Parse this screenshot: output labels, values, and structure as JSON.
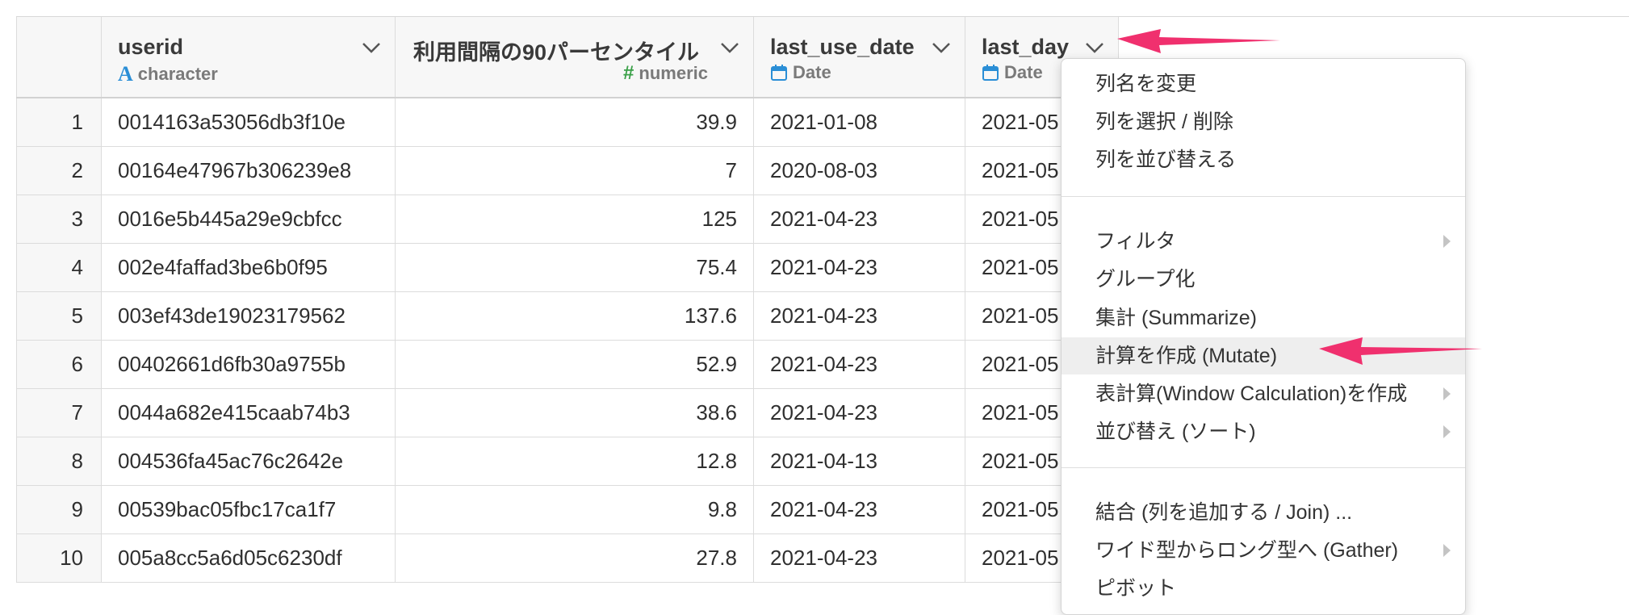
{
  "columns": [
    {
      "name": "userid",
      "type_label": "character",
      "type_icon": "character-type-icon",
      "align": "left"
    },
    {
      "name": "利用間隔の90パーセンタイル",
      "type_label": "numeric",
      "type_icon": "numeric-type-icon",
      "align": "right"
    },
    {
      "name": "last_use_date",
      "type_label": "Date",
      "type_icon": "calendar-icon",
      "align": "left"
    },
    {
      "name": "last_day",
      "type_label": "Date",
      "type_icon": "calendar-icon",
      "align": "left"
    }
  ],
  "rows": [
    {
      "num": "1",
      "userid": "0014163a53056db3f10e",
      "pct": "39.9",
      "last_use_date": "2021-01-08",
      "last_day": "2021-05"
    },
    {
      "num": "2",
      "userid": "00164e47967b306239e8",
      "pct": "7",
      "last_use_date": "2020-08-03",
      "last_day": "2021-05"
    },
    {
      "num": "3",
      "userid": "0016e5b445a29e9cbfcc",
      "pct": "125",
      "last_use_date": "2021-04-23",
      "last_day": "2021-05"
    },
    {
      "num": "4",
      "userid": "002e4faffad3be6b0f95",
      "pct": "75.4",
      "last_use_date": "2021-04-23",
      "last_day": "2021-05"
    },
    {
      "num": "5",
      "userid": "003ef43de19023179562",
      "pct": "137.6",
      "last_use_date": "2021-04-23",
      "last_day": "2021-05"
    },
    {
      "num": "6",
      "userid": "00402661d6fb30a9755b",
      "pct": "52.9",
      "last_use_date": "2021-04-23",
      "last_day": "2021-05"
    },
    {
      "num": "7",
      "userid": "0044a682e415caab74b3",
      "pct": "38.6",
      "last_use_date": "2021-04-23",
      "last_day": "2021-05"
    },
    {
      "num": "8",
      "userid": "004536fa45ac76c2642e",
      "pct": "12.8",
      "last_use_date": "2021-04-13",
      "last_day": "2021-05"
    },
    {
      "num": "9",
      "userid": "00539bac05fbc17ca1f7",
      "pct": "9.8",
      "last_use_date": "2021-04-23",
      "last_day": "2021-05"
    },
    {
      "num": "10",
      "userid": "005a8cc5a6d05c6230df",
      "pct": "27.8",
      "last_use_date": "2021-04-23",
      "last_day": "2021-05"
    }
  ],
  "menu": {
    "items": [
      {
        "label": "列名を変更",
        "submenu": false,
        "highlighted": false
      },
      {
        "label": "列を選択 / 削除",
        "submenu": false,
        "highlighted": false
      },
      {
        "label": "列を並び替える",
        "submenu": false,
        "highlighted": false
      },
      {
        "label": "フィルタ",
        "submenu": true,
        "highlighted": false
      },
      {
        "label": "グループ化",
        "submenu": false,
        "highlighted": false
      },
      {
        "label": "集計 (Summarize)",
        "submenu": false,
        "highlighted": false
      },
      {
        "label": "計算を作成 (Mutate)",
        "submenu": false,
        "highlighted": true
      },
      {
        "label": "表計算(Window Calculation)を作成",
        "submenu": true,
        "highlighted": false
      },
      {
        "label": "並び替え (ソート)",
        "submenu": true,
        "highlighted": false
      },
      {
        "label": "結合 (列を追加する / Join) ...",
        "submenu": false,
        "highlighted": false
      },
      {
        "label": "ワイド型からロング型へ (Gather)",
        "submenu": true,
        "highlighted": false
      },
      {
        "label": "ピボット",
        "submenu": false,
        "highlighted": false
      }
    ]
  },
  "colors": {
    "annotation_arrow": "#f0306e",
    "character_icon": "#2a8ed6",
    "numeric_icon": "#3aa048",
    "date_icon": "#2a8ed6",
    "menu_highlight": "#eeeeee"
  }
}
